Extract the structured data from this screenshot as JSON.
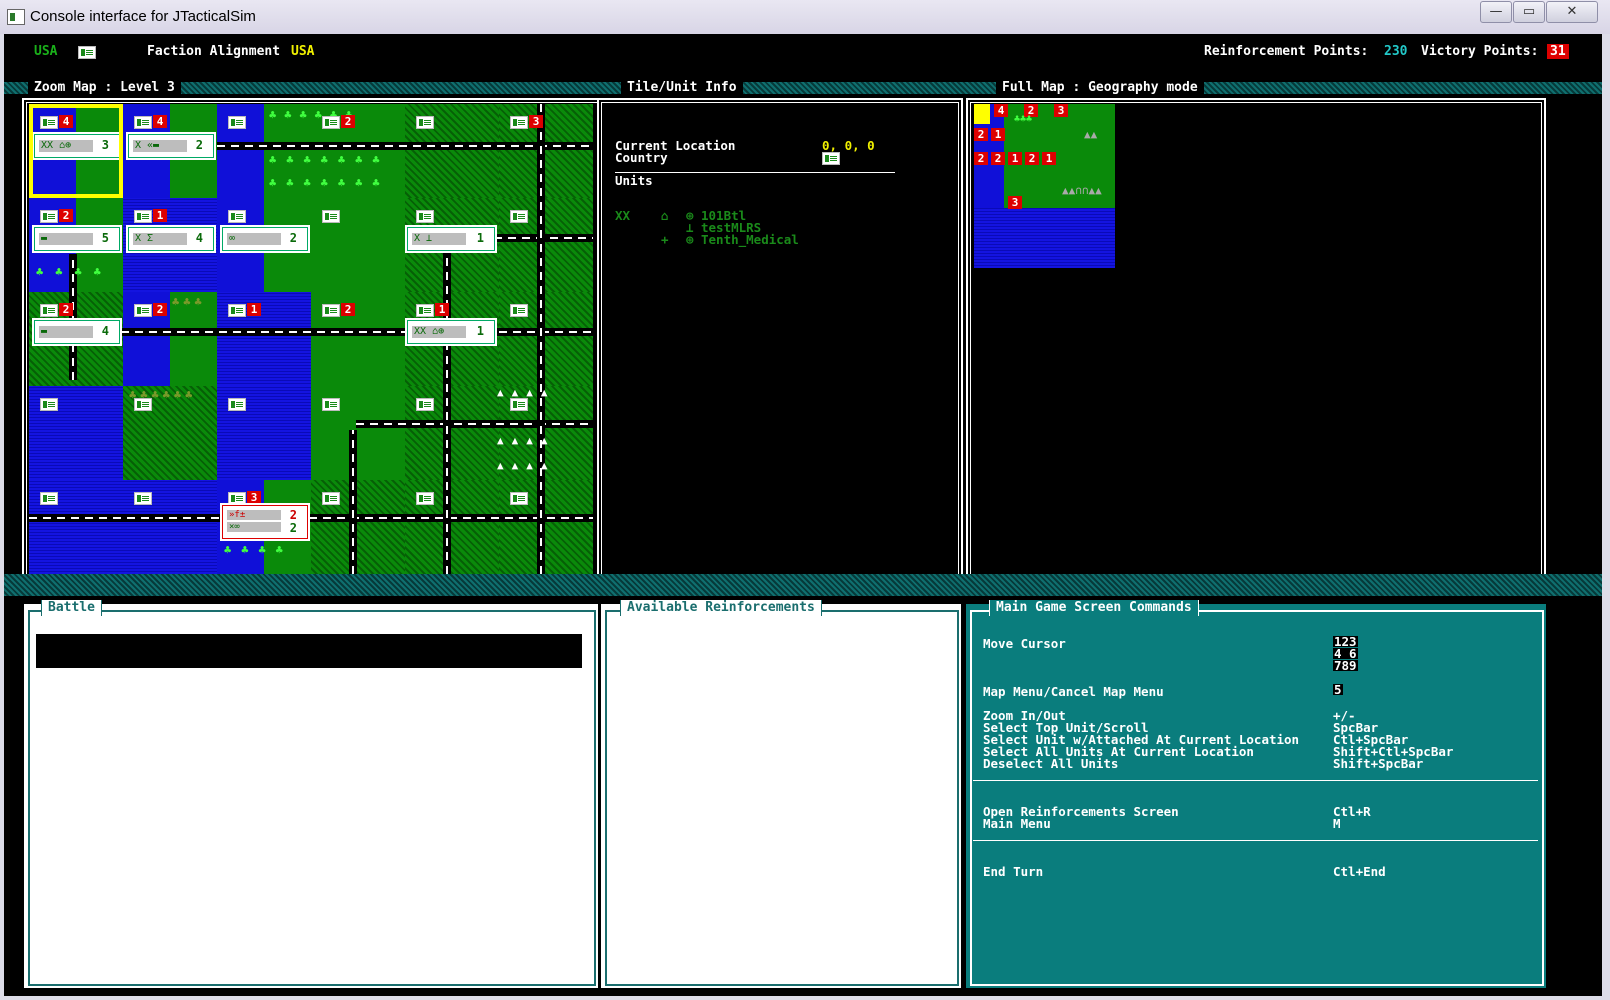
{
  "window": {
    "title": "Console interface for JTacticalSim",
    "min": "—",
    "max": "▭",
    "close": "✕"
  },
  "topbar": {
    "faction_short": "USA",
    "faction_label": "Faction Alignment",
    "faction_value": "USA",
    "reinforcement_label": "Reinforcement Points:",
    "reinforcement_value": "230",
    "victory_label": "Victory Points:",
    "victory_value": "31"
  },
  "panels": {
    "zoom_map": "Zoom Map : Level 3",
    "tile_info": "Tile/Unit Info",
    "full_map": "Full Map : Geography mode",
    "battle": "Battle",
    "reinforcements": "Available Reinforcements",
    "commands": "Main Game Screen Commands"
  },
  "tile_info": {
    "location_label": "Current Location",
    "location_value": "0, 0, 0",
    "country_label": "Country",
    "units_label": "Units",
    "units": [
      {
        "size": "XX",
        "type": "⌂",
        "mark": "⊕",
        "name": "101Btl"
      },
      {
        "size": "",
        "type": "",
        "mark": "⊥",
        "name": "testMLRS"
      },
      {
        "size": "",
        "type": "+",
        "mark": "⊕",
        "name": "Tenth_Medical"
      }
    ]
  },
  "zoom_map": {
    "flag_counts": [
      "4",
      "4",
      "2",
      "3",
      "2",
      "1",
      "2",
      "2",
      "1",
      "2",
      "1",
      "3"
    ],
    "unit_boxes": [
      {
        "sym": "XX ⌂⊕",
        "num": "3"
      },
      {
        "sym": "X «▬",
        "num": "2"
      },
      {
        "sym": "▬",
        "num": "5"
      },
      {
        "sym": "X  Σ",
        "num": "4"
      },
      {
        "sym": "  ∞",
        "num": "2"
      },
      {
        "sym": "X  ⊥",
        "num": "1"
      },
      {
        "sym": "▬",
        "num": "4"
      },
      {
        "sym": "XX ⌂⊕",
        "num": "1"
      },
      {
        "sym": "»f±",
        "num": "2"
      },
      {
        "sym": "×∞",
        "num": "2"
      }
    ]
  },
  "full_map": {
    "counts": [
      "4",
      "2",
      "3",
      "2",
      "1",
      "2",
      "2",
      "1",
      "2",
      "1",
      "3"
    ]
  },
  "commands": [
    {
      "label": "Move Cursor",
      "key": "123"
    },
    {
      "label": "",
      "key": "4 6"
    },
    {
      "label": "",
      "key": "789"
    },
    {
      "label": "Map Menu/Cancel Map Menu",
      "key": "5"
    },
    {
      "label": "Zoom In/Out",
      "key": "+/-"
    },
    {
      "label": "Select Top Unit/Scroll",
      "key": "SpcBar"
    },
    {
      "label": "Select Unit w/Attached At Current Location",
      "key": "Ctl+SpcBar"
    },
    {
      "label": "Select All Units At Current Location",
      "key": "Shift+Ctl+SpcBar"
    },
    {
      "label": "Deselect All Units",
      "key": "Shift+SpcBar"
    },
    {
      "label": "Open Reinforcements Screen",
      "key": "Ctl+R"
    },
    {
      "label": "Main Menu",
      "key": "M"
    },
    {
      "label": "End Turn",
      "key": "Ctl+End"
    }
  ]
}
